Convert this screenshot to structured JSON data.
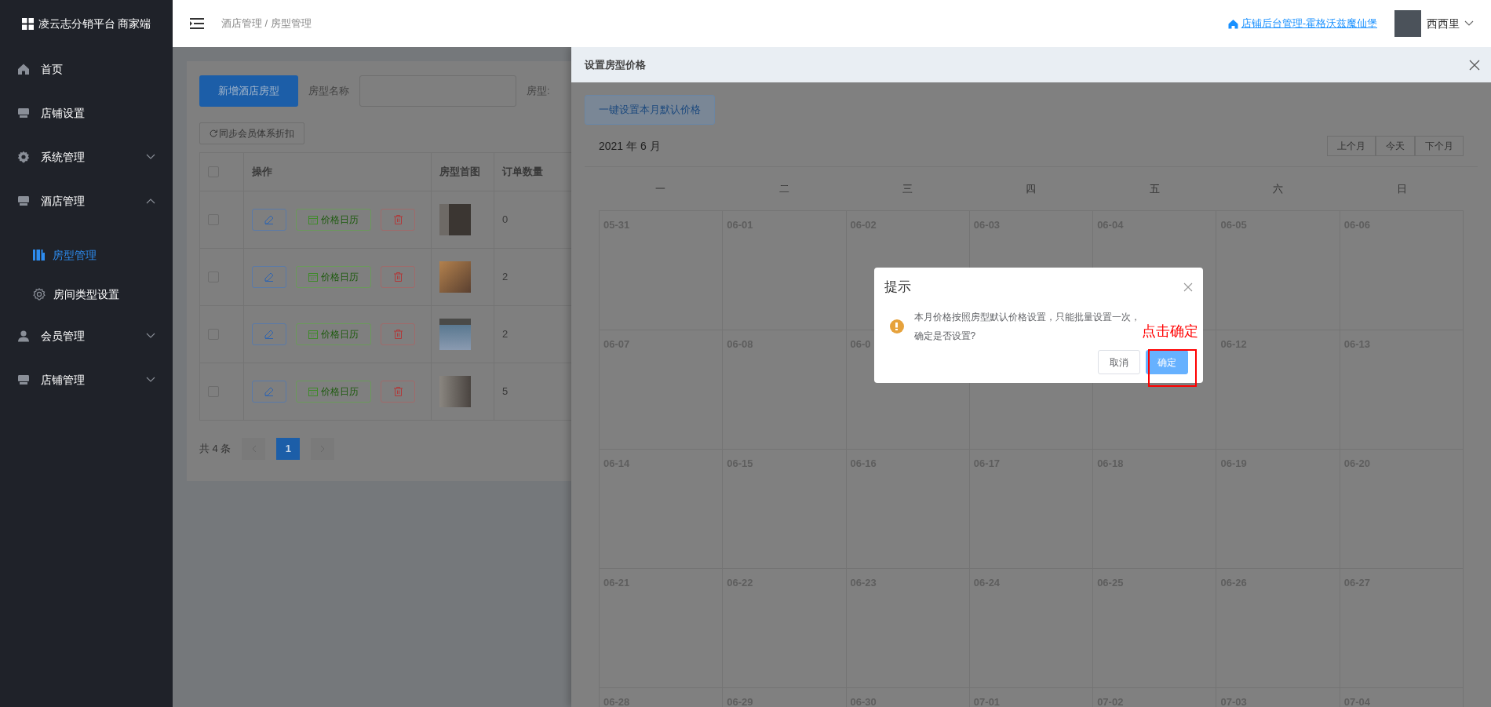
{
  "sidebar": {
    "logo": "凌云志分销平台 商家端",
    "items": [
      {
        "kind": "link",
        "label": "首页",
        "selected": false
      },
      {
        "kind": "link",
        "label": "店铺设置",
        "selected": false
      },
      {
        "kind": "group",
        "label": "系统管理",
        "selected": false,
        "expanded": false
      },
      {
        "kind": "group",
        "label": "酒店管理",
        "selected": false,
        "expanded": true,
        "children": [
          {
            "label": "房型管理",
            "selected": true
          },
          {
            "label": "房间类型设置",
            "selected": false
          }
        ]
      },
      {
        "kind": "group",
        "label": "会员管理",
        "selected": false,
        "expanded": false
      },
      {
        "kind": "group",
        "label": "店铺管理",
        "selected": false,
        "expanded": false
      }
    ]
  },
  "header": {
    "breadcrumb": [
      "酒店管理",
      "房型管理"
    ],
    "separator": "/",
    "shop_link": "店铺后台管理-霍格沃兹魔仙堡",
    "user": "西西里"
  },
  "room_list": {
    "add_button": "新增酒店房型",
    "name_filter": {
      "label": "房型名称"
    },
    "type_filter_label": "房型:",
    "sync_button": "同步会员体系折扣",
    "columns": [
      "操作",
      "房型首图",
      "订单数量"
    ],
    "header_checked": false,
    "rows": [
      {
        "checked": false,
        "calendar_button": "价格日历",
        "orders": "0"
      },
      {
        "checked": false,
        "calendar_button": "价格日历",
        "orders": "2"
      },
      {
        "checked": false,
        "calendar_button": "价格日历",
        "orders": "2"
      },
      {
        "checked": false,
        "calendar_button": "价格日历",
        "orders": "5"
      }
    ],
    "pagination": {
      "total": "共 4 条",
      "pages": [
        {
          "label": "1",
          "selected": true
        }
      ]
    }
  },
  "drawer": {
    "title": "设置房型价格",
    "default_price_button": "一键设置本月默认价格",
    "month": "2021 年 6 月",
    "nav_buttons": [
      "上个月",
      "今天",
      "下个月"
    ],
    "weekdays": [
      "一",
      "二",
      "三",
      "四",
      "五",
      "六",
      "日"
    ],
    "weeks": [
      {
        "days": [
          "05-31",
          "06-01",
          "06-02",
          "06-03",
          "06-04",
          "06-05",
          "06-06"
        ]
      },
      {
        "days": [
          "06-07",
          "06-08",
          "06-0"
        ],
        "days_right": [
          "06-12",
          "06-13"
        ]
      },
      {
        "days": [
          "06-14",
          "06-15",
          "06-16",
          "06-17",
          "06-18",
          "06-19",
          "06-20"
        ]
      },
      {
        "days": [
          "06-21",
          "06-22",
          "06-23",
          "06-24",
          "06-25",
          "06-26",
          "06-27"
        ]
      },
      {
        "days": [
          "06-28",
          "06-29",
          "06-30",
          "07-01",
          "07-02",
          "07-03",
          "07-04"
        ]
      }
    ]
  },
  "dialog": {
    "title": "提示",
    "message_lines": [
      "本月价格按照房型默认价格设置，只能批量设置一次，",
      "确定是否设置?"
    ],
    "buttons": [
      {
        "label": "取消",
        "kind": "default"
      },
      {
        "label": "确定",
        "kind": "primary"
      }
    ]
  },
  "annotation": {
    "text": "点击确定"
  }
}
